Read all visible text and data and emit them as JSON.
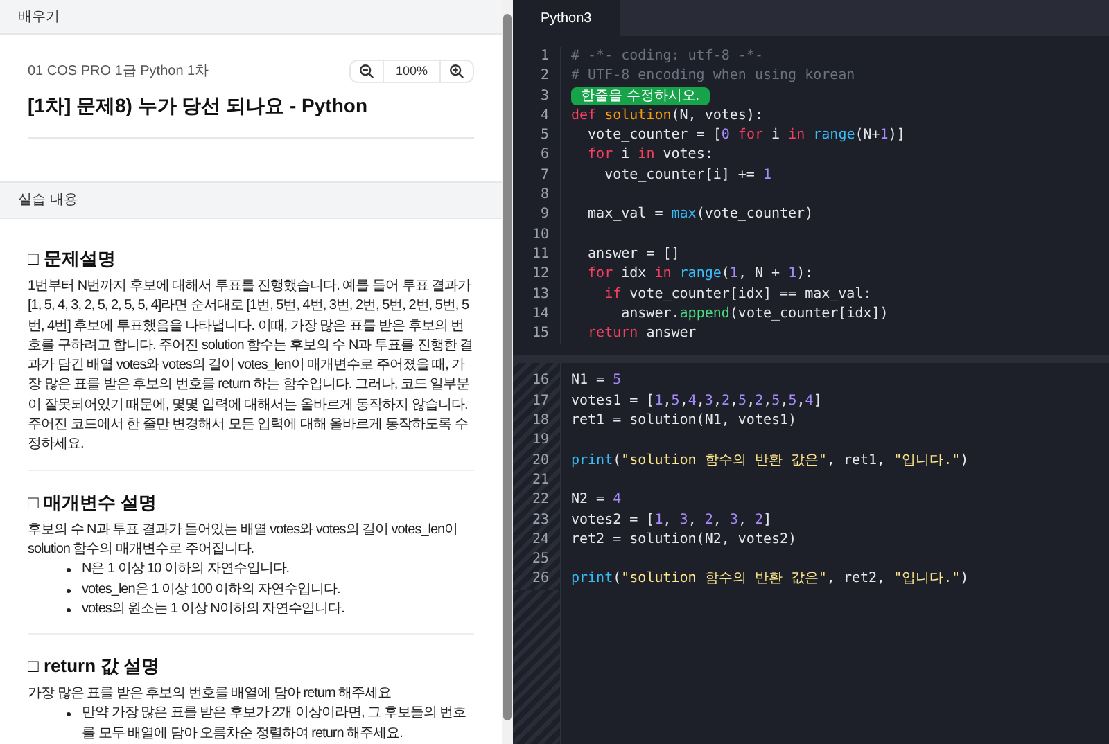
{
  "left_panel": {
    "header": "배우기",
    "course": "01 COS PRO 1급 Python 1차",
    "zoom": {
      "value": "100%"
    },
    "title": "[1차] 문제8) 누가 당선 되나요 - Python",
    "section_bar": "실습 내용",
    "sections": [
      {
        "heading": "□ 문제설명",
        "text": "1번부터 N번까지 후보에 대해서 투표를 진행했습니다. 예를 들어 투표 결과가 [1, 5, 4, 3, 2, 5, 2, 5, 5, 4]라면 순서대로 [1번, 5번, 4번, 3번, 2번, 5번, 2번, 5번, 5번, 4번] 후보에 투표했음을 나타냅니다. 이때, 가장 많은 표를 받은 후보의 번호를 구하려고 합니다. 주어진 solution 함수는 후보의 수 N과 투표를 진행한 결과가 담긴 배열 votes와 votes의 길이 votes_len이 매개변수로 주어졌을 때, 가장 많은 표를 받은 후보의 번호를 return 하는 함수입니다. 그러나, 코드 일부분이 잘못되어있기 때문에, 몇몇 입력에 대해서는 올바르게 동작하지 않습니다. 주어진 코드에서 한 줄만 변경해서 모든 입력에 대해 올바르게 동작하도록 수정하세요."
      },
      {
        "heading": "□ 매개변수 설명",
        "text": "후보의 수 N과 투표 결과가 들어있는 배열 votes와 votes의 길이 votes_len이 solution 함수의 매개변수로 주어집니다.",
        "bullets": [
          "N은 1 이상 10 이하의 자연수입니다.",
          "votes_len은 1 이상 100 이하의 자연수입니다.",
          "votes의 원소는 1 이상 N이하의 자연수입니다."
        ]
      },
      {
        "heading": "□ return 값 설명",
        "text": "가장 많은 표를 받은 후보의 번호를 배열에 담아 return 해주세요",
        "bullets": [
          "만약 가장 많은 표를 받은 후보가 2개 이상이라면, 그 후보들의 번호를 모두 배열에 담아 오름차순 정렬하여 return 해주세요."
        ]
      }
    ]
  },
  "editor": {
    "tabs": [
      {
        "label": "Python3",
        "selected": true
      }
    ],
    "sections": [
      {
        "kind": "editable",
        "lines": [
          {
            "no": "1",
            "tokens": [
              {
                "kind": "comment",
                "text": "# -*- coding: utf-8 -*-"
              }
            ]
          },
          {
            "no": "2",
            "tokens": [
              {
                "kind": "comment",
                "text": "# UTF-8 encoding when using korean"
              }
            ]
          },
          {
            "no": "3",
            "hint": "한줄을 수정하시오."
          },
          {
            "no": "4",
            "tokens": [
              {
                "kind": "kw",
                "text": "def"
              },
              {
                "kind": "def",
                "text": " solution"
              },
              {
                "kind": "plain",
                "text": "(N, votes):"
              }
            ]
          },
          {
            "no": "5",
            "tokens": [
              {
                "kind": "plain",
                "text": "  vote_counter = ["
              },
              {
                "kind": "num",
                "text": "0"
              },
              {
                "kind": "kw",
                "text": " for"
              },
              {
                "kind": "plain",
                "text": " i "
              },
              {
                "kind": "kw",
                "text": "in"
              },
              {
                "kind": "builtin",
                "text": " range"
              },
              {
                "kind": "plain",
                "text": "(N+"
              },
              {
                "kind": "num",
                "text": "1"
              },
              {
                "kind": "plain",
                "text": ")]"
              }
            ]
          },
          {
            "no": "6",
            "tokens": [
              {
                "kind": "kw",
                "text": "  for"
              },
              {
                "kind": "plain",
                "text": " i "
              },
              {
                "kind": "kw",
                "text": "in"
              },
              {
                "kind": "plain",
                "text": " votes:"
              }
            ]
          },
          {
            "no": "7",
            "tokens": [
              {
                "kind": "plain",
                "text": "    vote_counter[i] += "
              },
              {
                "kind": "num",
                "text": "1"
              }
            ]
          },
          {
            "no": "8"
          },
          {
            "no": "9",
            "tokens": [
              {
                "kind": "plain",
                "text": "  max_val = "
              },
              {
                "kind": "builtin",
                "text": "max"
              },
              {
                "kind": "plain",
                "text": "(vote_counter)"
              }
            ]
          },
          {
            "no": "10"
          },
          {
            "no": "11",
            "tokens": [
              {
                "kind": "plain",
                "text": "  answer = []"
              }
            ]
          },
          {
            "no": "12",
            "tokens": [
              {
                "kind": "kw",
                "text": "  for"
              },
              {
                "kind": "plain",
                "text": " idx "
              },
              {
                "kind": "kw",
                "text": "in"
              },
              {
                "kind": "builtin",
                "text": " range"
              },
              {
                "kind": "plain",
                "text": "("
              },
              {
                "kind": "num",
                "text": "1"
              },
              {
                "kind": "plain",
                "text": ", N + "
              },
              {
                "kind": "num",
                "text": "1"
              },
              {
                "kind": "plain",
                "text": "):"
              }
            ]
          },
          {
            "no": "13",
            "tokens": [
              {
                "kind": "kw",
                "text": "    if"
              },
              {
                "kind": "plain",
                "text": " vote_counter[idx] == max_val:"
              }
            ]
          },
          {
            "no": "14",
            "tokens": [
              {
                "kind": "plain",
                "text": "      answer."
              },
              {
                "kind": "method",
                "text": "append"
              },
              {
                "kind": "plain",
                "text": "(vote_counter[idx])"
              }
            ]
          },
          {
            "no": "15",
            "tokens": [
              {
                "kind": "kw",
                "text": "  return"
              },
              {
                "kind": "plain",
                "text": " answer"
              }
            ]
          }
        ]
      },
      {
        "kind": "fixed",
        "lines": [
          {
            "no": "16",
            "tokens": [
              {
                "kind": "plain",
                "text": "N1 = "
              },
              {
                "kind": "num",
                "text": "5"
              }
            ]
          },
          {
            "no": "17",
            "tokens": [
              {
                "kind": "plain",
                "text": "votes1 = ["
              },
              {
                "kind": "num",
                "text": "1"
              },
              {
                "kind": "plain",
                "text": ","
              },
              {
                "kind": "num",
                "text": "5"
              },
              {
                "kind": "plain",
                "text": ","
              },
              {
                "kind": "num",
                "text": "4"
              },
              {
                "kind": "plain",
                "text": ","
              },
              {
                "kind": "num",
                "text": "3"
              },
              {
                "kind": "plain",
                "text": ","
              },
              {
                "kind": "num",
                "text": "2"
              },
              {
                "kind": "plain",
                "text": ","
              },
              {
                "kind": "num",
                "text": "5"
              },
              {
                "kind": "plain",
                "text": ","
              },
              {
                "kind": "num",
                "text": "2"
              },
              {
                "kind": "plain",
                "text": ","
              },
              {
                "kind": "num",
                "text": "5"
              },
              {
                "kind": "plain",
                "text": ","
              },
              {
                "kind": "num",
                "text": "5"
              },
              {
                "kind": "plain",
                "text": ","
              },
              {
                "kind": "num",
                "text": "4"
              },
              {
                "kind": "plain",
                "text": "]"
              }
            ]
          },
          {
            "no": "18",
            "tokens": [
              {
                "kind": "plain",
                "text": "ret1 = solution(N1, votes1)"
              }
            ]
          },
          {
            "no": "19"
          },
          {
            "no": "20",
            "tokens": [
              {
                "kind": "builtin",
                "text": "print"
              },
              {
                "kind": "plain",
                "text": "("
              },
              {
                "kind": "str",
                "text": "\"solution 함수의 반환 값은\""
              },
              {
                "kind": "plain",
                "text": ", ret1, "
              },
              {
                "kind": "str",
                "text": "\"입니다.\""
              },
              {
                "kind": "plain",
                "text": ")"
              }
            ]
          },
          {
            "no": "21"
          },
          {
            "no": "22",
            "tokens": [
              {
                "kind": "plain",
                "text": "N2 = "
              },
              {
                "kind": "num",
                "text": "4"
              }
            ]
          },
          {
            "no": "23",
            "tokens": [
              {
                "kind": "plain",
                "text": "votes2 = ["
              },
              {
                "kind": "num",
                "text": "1"
              },
              {
                "kind": "plain",
                "text": ", "
              },
              {
                "kind": "num",
                "text": "3"
              },
              {
                "kind": "plain",
                "text": ", "
              },
              {
                "kind": "num",
                "text": "2"
              },
              {
                "kind": "plain",
                "text": ", "
              },
              {
                "kind": "num",
                "text": "3"
              },
              {
                "kind": "plain",
                "text": ", "
              },
              {
                "kind": "num",
                "text": "2"
              },
              {
                "kind": "plain",
                "text": "]"
              }
            ]
          },
          {
            "no": "24",
            "tokens": [
              {
                "kind": "plain",
                "text": "ret2 = solution(N2, votes2)"
              }
            ]
          },
          {
            "no": "25"
          },
          {
            "no": "26",
            "tokens": [
              {
                "kind": "builtin",
                "text": "print"
              },
              {
                "kind": "plain",
                "text": "("
              },
              {
                "kind": "str",
                "text": "\"solution 함수의 반환 값은\""
              },
              {
                "kind": "plain",
                "text": ", ret2, "
              },
              {
                "kind": "str",
                "text": "\"입니다.\""
              },
              {
                "kind": "plain",
                "text": ")"
              }
            ]
          }
        ]
      }
    ]
  }
}
